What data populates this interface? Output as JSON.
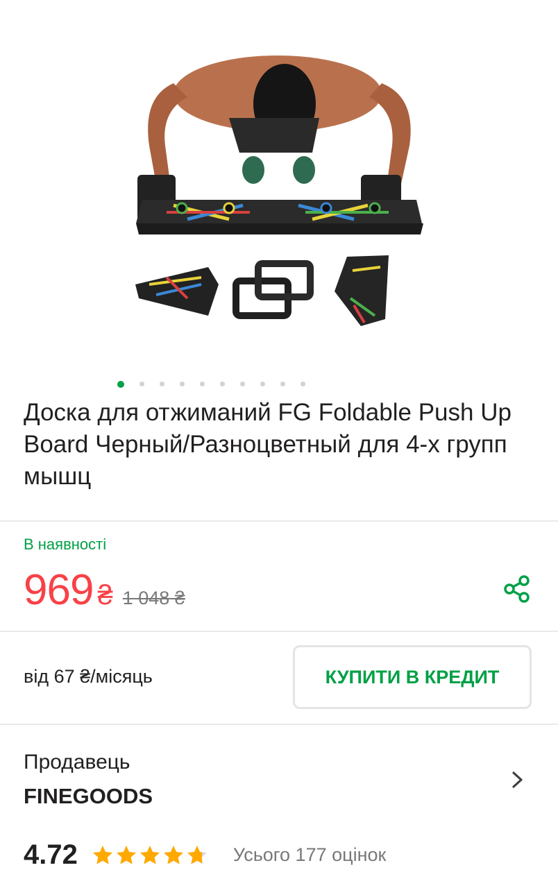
{
  "product": {
    "title": "Доска для отжиманий FG Foldable Push Up Board Черный/Разноцветный для 4-х групп мышц",
    "gallery": {
      "total_images": 10,
      "active_index": 0
    }
  },
  "availability": {
    "status": "В наявності"
  },
  "price": {
    "current": "969",
    "currency": "₴",
    "old": "1 048 ₴"
  },
  "credit": {
    "monthly_text": "від 67 ₴/місяць",
    "button_label": "КУПИТИ В КРЕДИТ"
  },
  "seller": {
    "label": "Продавець",
    "name": "FINEGOODS"
  },
  "rating": {
    "score": "4.72",
    "stars_value": 4.72,
    "stars_max": 5,
    "reviews_text": "Усього 177 оцінок"
  },
  "icons": {
    "share": "share-icon",
    "chevron": "chevron-right-icon",
    "star": "star-icon"
  },
  "colors": {
    "accent_green": "#00a046",
    "price_red": "#f84147",
    "star_yellow": "#ffa900",
    "text_dark": "#221f1f",
    "text_grey": "#797878"
  }
}
